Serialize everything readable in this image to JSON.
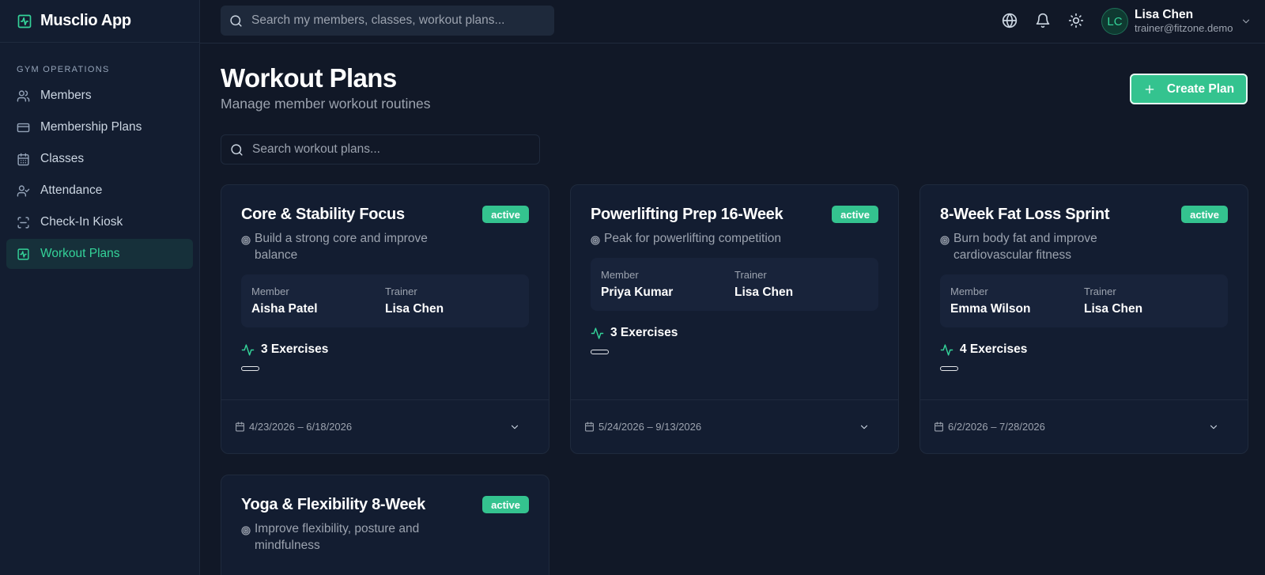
{
  "app": {
    "name": "Musclio App"
  },
  "sidebar": {
    "section_label": "GYM OPERATIONS",
    "items": [
      {
        "label": "Members",
        "icon": "users-icon"
      },
      {
        "label": "Membership Plans",
        "icon": "credit-card-icon"
      },
      {
        "label": "Classes",
        "icon": "calendar-icon"
      },
      {
        "label": "Attendance",
        "icon": "user-check-icon"
      },
      {
        "label": "Check-In Kiosk",
        "icon": "scan-icon"
      },
      {
        "label": "Workout Plans",
        "icon": "activity-square-icon",
        "active": true
      }
    ]
  },
  "topbar": {
    "search_placeholder": "Search my members, classes, workout plans...",
    "user": {
      "initials": "LC",
      "name": "Lisa Chen",
      "email": "trainer@fitzone.demo"
    }
  },
  "main": {
    "title": "Workout Plans",
    "subtitle": "Manage member workout routines",
    "create_label": "Create Plan",
    "search_placeholder": "Search workout plans..."
  },
  "labels": {
    "member": "Member",
    "trainer": "Trainer"
  },
  "plans": [
    {
      "title": "Core & Stability Focus",
      "status": "active",
      "goal": "Build a strong core and improve balance",
      "member": "Aisha Patel",
      "trainer": "Lisa Chen",
      "exercises": "3 Exercises",
      "dates": "4/23/2026 – 6/18/2026"
    },
    {
      "title": "Powerlifting Prep 16-Week",
      "status": "active",
      "goal": "Peak for powerlifting competition",
      "member": "Priya Kumar",
      "trainer": "Lisa Chen",
      "exercises": "3 Exercises",
      "dates": "5/24/2026 – 9/13/2026"
    },
    {
      "title": "8-Week Fat Loss Sprint",
      "status": "active",
      "goal": "Burn body fat and improve cardiovascular fitness",
      "member": "Emma Wilson",
      "trainer": "Lisa Chen",
      "exercises": "4 Exercises",
      "dates": "6/2/2026 – 7/28/2026"
    },
    {
      "title": "Yoga & Flexibility 8-Week",
      "status": "active",
      "goal": "Improve flexibility, posture and mindfulness"
    }
  ],
  "colors": {
    "accent": "#34d399",
    "button": "#34c38f",
    "background": "#111827",
    "card": "#131d31"
  }
}
